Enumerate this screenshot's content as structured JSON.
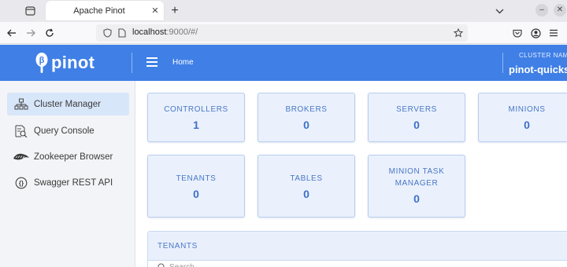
{
  "browser": {
    "tab_title": "Apache Pinot",
    "tab_close": "✕",
    "new_tab": "+",
    "url_host": "localhost",
    "url_rest": ":9000/#/",
    "window_controls": {
      "minimize": "–",
      "close": "✕"
    }
  },
  "header": {
    "logo_text": "pinot",
    "breadcrumb": "Home",
    "cluster_caption": "CLUSTER NAM",
    "cluster_name": "pinot-quickst"
  },
  "sidebar": {
    "items": [
      {
        "label": "Cluster Manager",
        "icon": "cluster-icon",
        "active": true
      },
      {
        "label": "Query Console",
        "icon": "query-icon",
        "active": false
      },
      {
        "label": "Zookeeper Browser",
        "icon": "zookeeper-icon",
        "active": false
      },
      {
        "label": "Swagger REST API",
        "icon": "api-icon",
        "active": false
      }
    ]
  },
  "cards": [
    {
      "title": "CONTROLLERS",
      "value": "1"
    },
    {
      "title": "BROKERS",
      "value": "0"
    },
    {
      "title": "SERVERS",
      "value": "0"
    },
    {
      "title": "MINIONS",
      "value": "0"
    },
    {
      "title": "TENANTS",
      "value": "0"
    },
    {
      "title": "TABLES",
      "value": "0"
    },
    {
      "title": "MINION TASK MANAGER",
      "value": "0"
    }
  ],
  "tenants_panel": {
    "title": "TENANTS",
    "search_placeholder": "Search"
  },
  "colors": {
    "accent": "#3f7fe6",
    "card_bg": "#eaf1fc",
    "card_text": "#4a77c6",
    "sidebar_active": "#d8e6fa"
  }
}
